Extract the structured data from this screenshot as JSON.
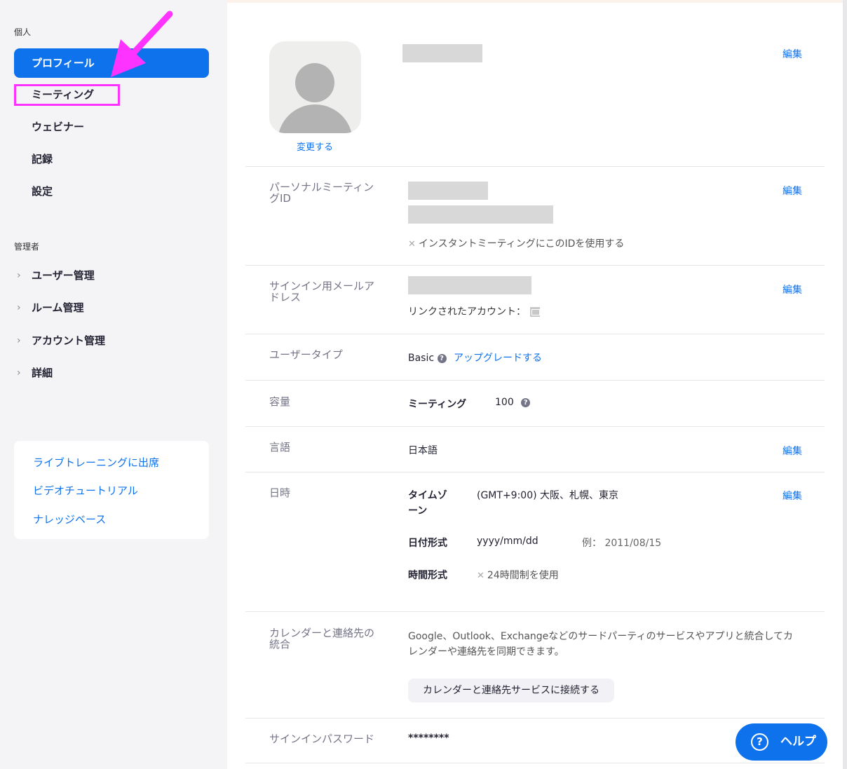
{
  "sidebar": {
    "personal_heading": "個人",
    "personal_items": [
      "プロフィール",
      "ミーティング",
      "ウェビナー",
      "記録",
      "設定"
    ],
    "admin_heading": "管理者",
    "admin_items": [
      "ユーザー管理",
      "ルーム管理",
      "アカウント管理",
      "詳細"
    ],
    "help_links": [
      "ライブトレーニングに出席",
      "ビデオチュートリアル",
      "ナレッジベース"
    ]
  },
  "profile": {
    "change_photo": "変更する",
    "edit_label": "編集",
    "pmi": {
      "label": "パーソナルミーティングID",
      "instant_option": "インスタントミーティングにこのIDを使用する"
    },
    "email": {
      "label": "サインイン用メールアドレス",
      "linked_accounts": "リンクされたアカウント："
    },
    "user_type": {
      "label": "ユーザータイプ",
      "value": "Basic",
      "upgrade": "アップグレードする"
    },
    "capacity": {
      "label": "容量",
      "item": "ミーティング",
      "value": "100"
    },
    "language": {
      "label": "言語",
      "value": "日本語"
    },
    "datetime": {
      "label": "日時",
      "timezone_label": "タイムゾーン",
      "timezone_value": "(GMT+9:00) 大阪、札幌、東京",
      "date_format_label": "日付形式",
      "date_format_value": "yyyy/mm/dd",
      "example": "例：  2011/08/15",
      "time_format_label": "時間形式",
      "time_format_value": "24時間制を使用"
    },
    "calendar": {
      "label": "カレンダーと連絡先の統合",
      "description": "Google、Outlook、Exchangeなどのサードパーティのサービスやアプリと統合してカレンダーや連絡先を同期できます。",
      "button": "カレンダーと連絡先サービスに接続する"
    },
    "password": {
      "label": "サインインパスワード",
      "value": "********"
    }
  },
  "help_button": "ヘルプ",
  "colors": {
    "accent": "#0e72ed",
    "annotation": "#ff33ff"
  }
}
